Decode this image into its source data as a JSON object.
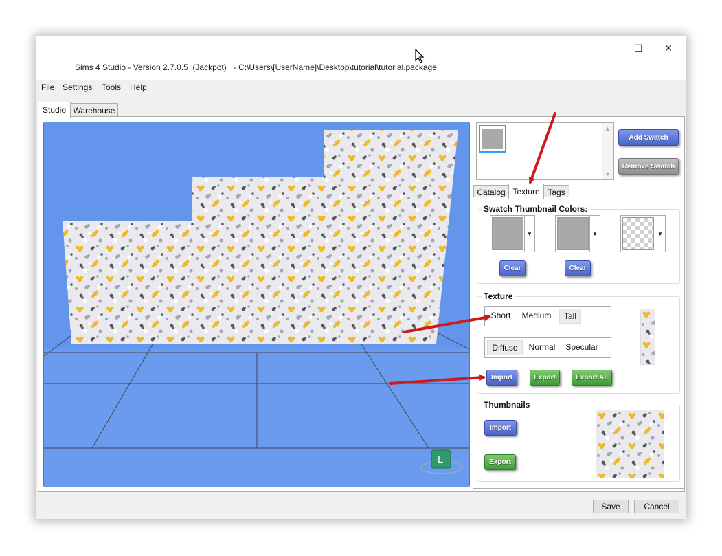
{
  "window": {
    "title": "Sims 4 Studio - Version 2.7.0.5  (Jackpot)   - C:\\Users\\[UserName]\\Desktop\\tutorial\\tutorial.package",
    "controls": {
      "minimize": "—",
      "maximize": "☐",
      "close": "✕"
    }
  },
  "menu": [
    "File",
    "Settings",
    "Tools",
    "Help"
  ],
  "main_tabs": {
    "studio": "Studio",
    "warehouse": "Warehouse",
    "active": "Studio"
  },
  "swatches": {
    "add_label": "Add Swatch",
    "remove_label": "Remove Swatch",
    "selected_color": "#a9a9a9"
  },
  "side_tabs": {
    "catalog": "Catalog",
    "texture": "Texture",
    "tags": "Tags",
    "active": "Texture"
  },
  "thumbnail_colors": {
    "title": "Swatch Thumbnail Colors:",
    "clear_label": "Clear",
    "colors": [
      "#a9a9a9",
      "#a9a9a9",
      "transparent"
    ]
  },
  "texture": {
    "title": "Texture",
    "sizes": [
      "Short",
      "Medium",
      "Tall"
    ],
    "selected_size": "Tall",
    "maps": [
      "Diffuse",
      "Normal",
      "Specular"
    ],
    "selected_map": "Diffuse",
    "import_label": "Import",
    "export_label": "Export",
    "export_all_label": "Export All"
  },
  "thumbnails": {
    "title": "Thumbnails",
    "import_label": "Import",
    "export_label": "Export"
  },
  "viewport": {
    "gizmo_label": "L",
    "background": "#6495ed"
  },
  "footer": {
    "save_label": "Save",
    "cancel_label": "Cancel"
  },
  "pattern_colors": {
    "yellow": "#f0b92a",
    "dark": "#55555c",
    "gray": "#a6a6ae",
    "background": "#e9e9ee"
  }
}
